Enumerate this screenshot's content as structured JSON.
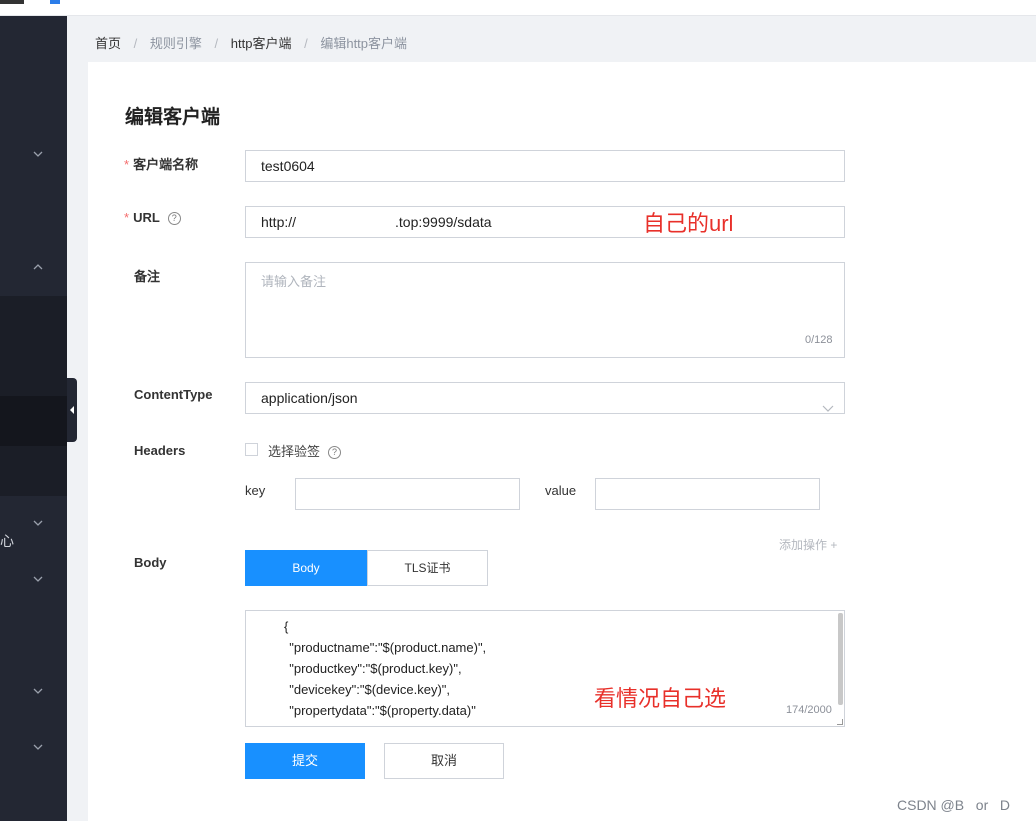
{
  "breadcrumb": {
    "home": "首页",
    "rule_engine": "规则引擎",
    "http_client": "http客户端",
    "edit_http_client": "编辑http客户端"
  },
  "page_title": "编辑客户端",
  "form": {
    "client_name_label": "客户端名称",
    "client_name_value": "test0604",
    "url_label": "URL",
    "url_value_start": "http://",
    "url_value_end": ".top:9999/sdata",
    "remark_label": "备注",
    "remark_placeholder": "请输入备注",
    "remark_counter": "0/128",
    "content_type_label": "ContentType",
    "content_type_value": "application/json",
    "headers_label": "Headers",
    "sign_checkbox_label": "选择验签",
    "key_label": "key",
    "value_label": "value",
    "add_operation": "添加操作 +",
    "body_label": "Body",
    "tabs": [
      "Body",
      "TLS证书"
    ],
    "body_lines": [
      "{",
      "  \"productname\":\"$(product.name)\",",
      "  \"productkey\":\"$(product.key)\",",
      "  \"devicekey\":\"$(device.key)\",",
      "  \"propertydata\":\"$(property.data)\""
    ],
    "body_counter": "174/2000",
    "submit_label": "提交",
    "cancel_label": "取消"
  },
  "annotations": {
    "url_note": "自己的url",
    "body_note": "看情况自己选"
  },
  "sidebar": {
    "partial_text": "心"
  },
  "watermark": "CSDN @B   or   D",
  "colors": {
    "primary": "#1890ff",
    "sidebar": "#232733",
    "required": "#f56c6c",
    "annotation": "#e8302a"
  }
}
